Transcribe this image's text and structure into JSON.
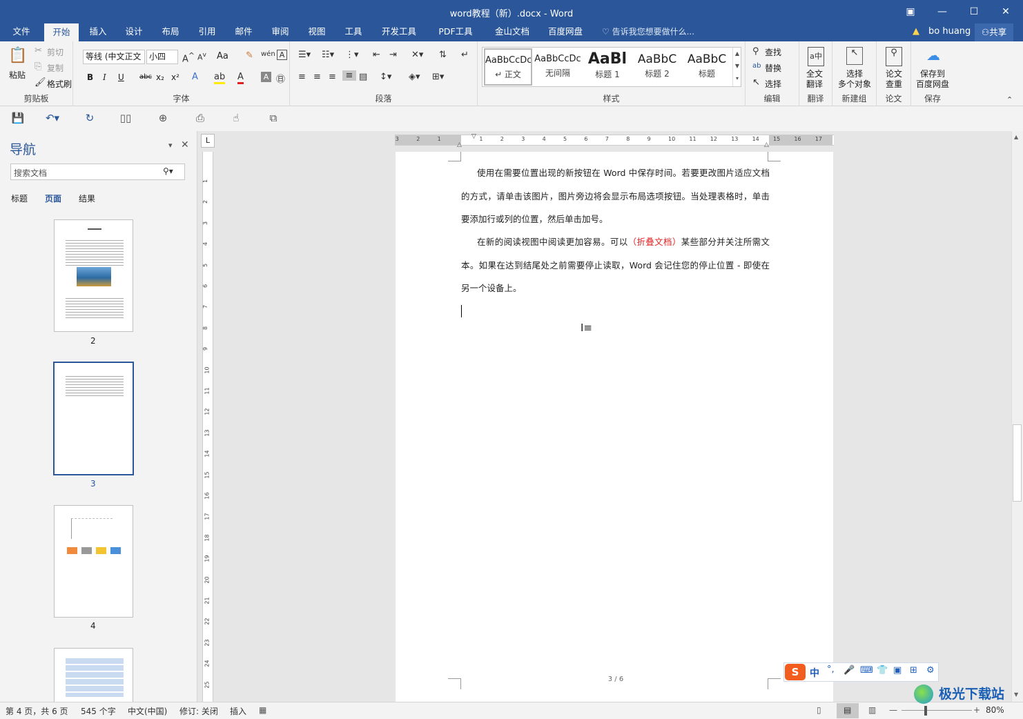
{
  "window": {
    "title": "word教程（新）.docx - Word",
    "controls": [
      "▣",
      "—",
      "☐",
      "✕"
    ]
  },
  "tabs": [
    {
      "label": "文件"
    },
    {
      "label": "开始",
      "active": true
    },
    {
      "label": "插入"
    },
    {
      "label": "设计"
    },
    {
      "label": "布局"
    },
    {
      "label": "引用"
    },
    {
      "label": "邮件"
    },
    {
      "label": "审阅"
    },
    {
      "label": "视图"
    },
    {
      "label": "工具"
    },
    {
      "label": "开发工具"
    },
    {
      "label": "PDF工具集"
    },
    {
      "label": "金山文档"
    },
    {
      "label": "百度网盘"
    }
  ],
  "tell_me": "告诉我您想要做什么...",
  "user": {
    "name": "bo huang",
    "share": "共享"
  },
  "ribbon": {
    "clipboard": {
      "paste": "粘贴",
      "cut": "剪切",
      "copy": "复制",
      "format_painter": "格式刷",
      "label": "剪贴板"
    },
    "font": {
      "font_name": "等线 (中文正文",
      "font_size": "小四",
      "aa": "Aa",
      "bold": "B",
      "italic": "I",
      "underline": "U",
      "strike": "abc",
      "sub": "x₂",
      "sup": "x²",
      "label": "字体"
    },
    "paragraph": {
      "label": "段落"
    },
    "styles": {
      "label": "样式",
      "items": [
        {
          "preview": "AaBbCcDc",
          "name": "↵ 正文"
        },
        {
          "preview": "AaBbCcDc",
          "name": "无间隔"
        },
        {
          "preview": "AaBl",
          "name": "标题 1"
        },
        {
          "preview": "AaBbC",
          "name": "标题 2"
        },
        {
          "preview": "AaBbC",
          "name": "标题"
        }
      ]
    },
    "editing": {
      "find": "查找",
      "replace": "替换",
      "select": "选择",
      "label": "编辑"
    },
    "translate": {
      "btn": "全文\n翻译",
      "label": "翻译"
    },
    "newgroup": {
      "btn": "选择\n多个对象",
      "label": "新建组"
    },
    "paper": {
      "btn": "论文\n查重",
      "label": "论文"
    },
    "save": {
      "btn": "保存到\n百度网盘",
      "label": "保存"
    }
  },
  "nav": {
    "title": "导航",
    "search_placeholder": "搜索文档",
    "tabs": [
      "标题",
      "页面",
      "结果"
    ],
    "active_tab": "页面",
    "pages": [
      "2",
      "3",
      "4"
    ]
  },
  "document": {
    "paragraphs": [
      {
        "text": "使用在需要位置出现的新按钮在 Word 中保存时间。若要更改图片适应文档的方式，请单击该图片，图片旁边将会显示布局选项按钮。当处理表格时，单击要添加行或列的位置，然后单击加号。"
      },
      {
        "before": "在新的阅读视图中阅读更加容易。可以",
        "highlight": "（折叠文档）",
        "after": "某些部分并关注所需文本。如果在达到结尾处之前需要停止读取，Word 会记住您的停止位置 - 即使在另一个设备上。"
      }
    ],
    "page_footer": "3 / 6",
    "highlight_color": "#e02020"
  },
  "ruler": {
    "h_ticks": [
      "3",
      "2",
      "1",
      "1",
      "2",
      "3",
      "4",
      "5",
      "6",
      "7",
      "8",
      "9",
      "10",
      "11",
      "12",
      "13",
      "14",
      "15",
      "16",
      "17"
    ],
    "v_ticks": [
      "1",
      "2",
      "3",
      "4",
      "5",
      "6",
      "7",
      "8",
      "9",
      "10",
      "11",
      "12",
      "13",
      "14",
      "15",
      "16",
      "17",
      "18",
      "19",
      "20",
      "21",
      "22",
      "23",
      "24",
      "25"
    ]
  },
  "ime": {
    "label": "中"
  },
  "status": {
    "page": "第 4 页，共 6 页",
    "words": "545 个字",
    "lang": "中文(中国)",
    "track": "修订: 关闭",
    "mode": "插入",
    "zoom": "80%"
  },
  "watermark": "极光下载站",
  "colors": {
    "accent": "#2b579a"
  }
}
